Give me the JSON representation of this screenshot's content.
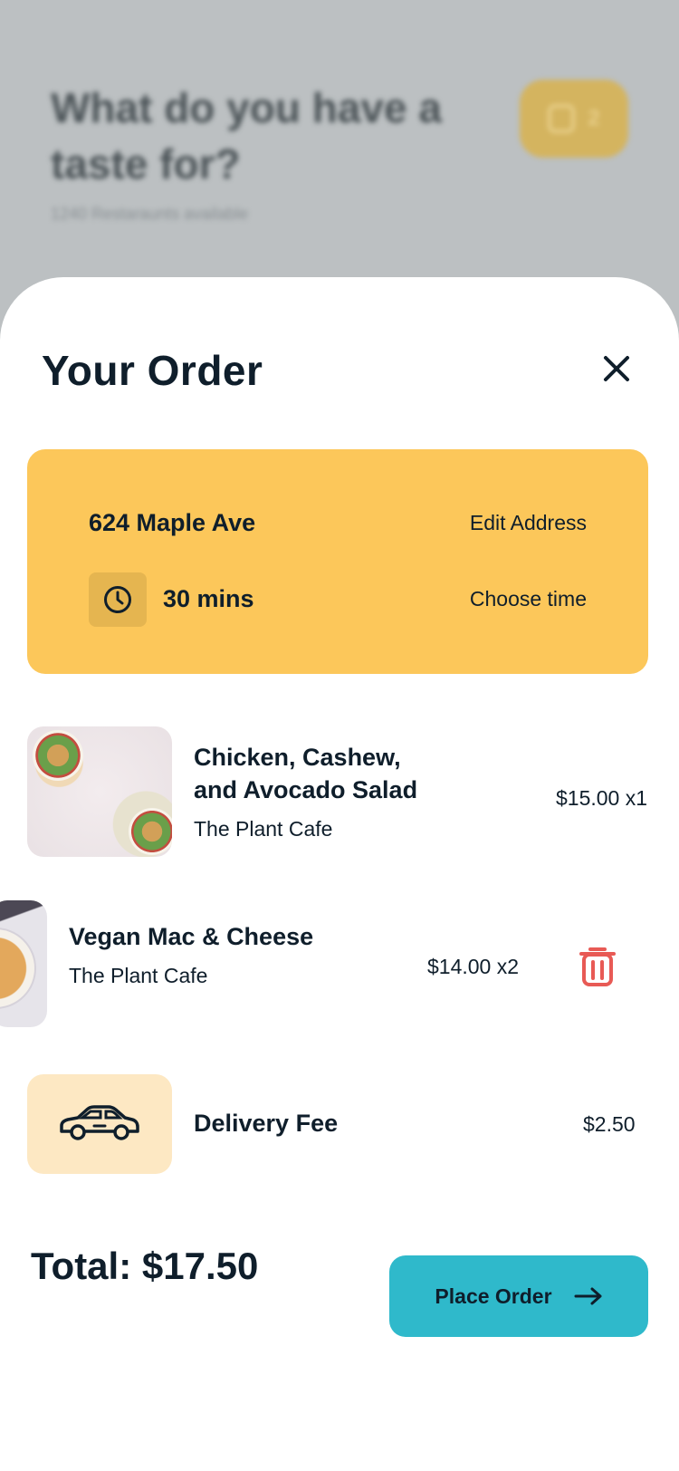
{
  "background": {
    "title": "What do you have a taste for?",
    "subtitle": "1240 Restaraunts available",
    "cart_count": "2"
  },
  "sheet": {
    "title": "Your Order",
    "close_icon": "close-icon"
  },
  "address_card": {
    "address": "624 Maple Ave",
    "edit_label": "Edit Address",
    "time": "30 mins",
    "choose_time_label": "Choose time",
    "accent": "#fcc75a"
  },
  "items": [
    {
      "name": "Chicken, Cashew, and Avocado Salad",
      "restaurant": "The Plant Cafe",
      "price": "$15.00 x1"
    },
    {
      "name": "Vegan Mac & Cheese",
      "restaurant": "The Plant Cafe",
      "price": "$14.00 x2",
      "action_icon": "trash-icon"
    }
  ],
  "delivery": {
    "label": "Delivery Fee",
    "price": "$2.50",
    "icon": "car-icon"
  },
  "footer": {
    "total": "Total: $17.50",
    "place_order_label": "Place Order",
    "button_color": "#2fb9cb"
  }
}
